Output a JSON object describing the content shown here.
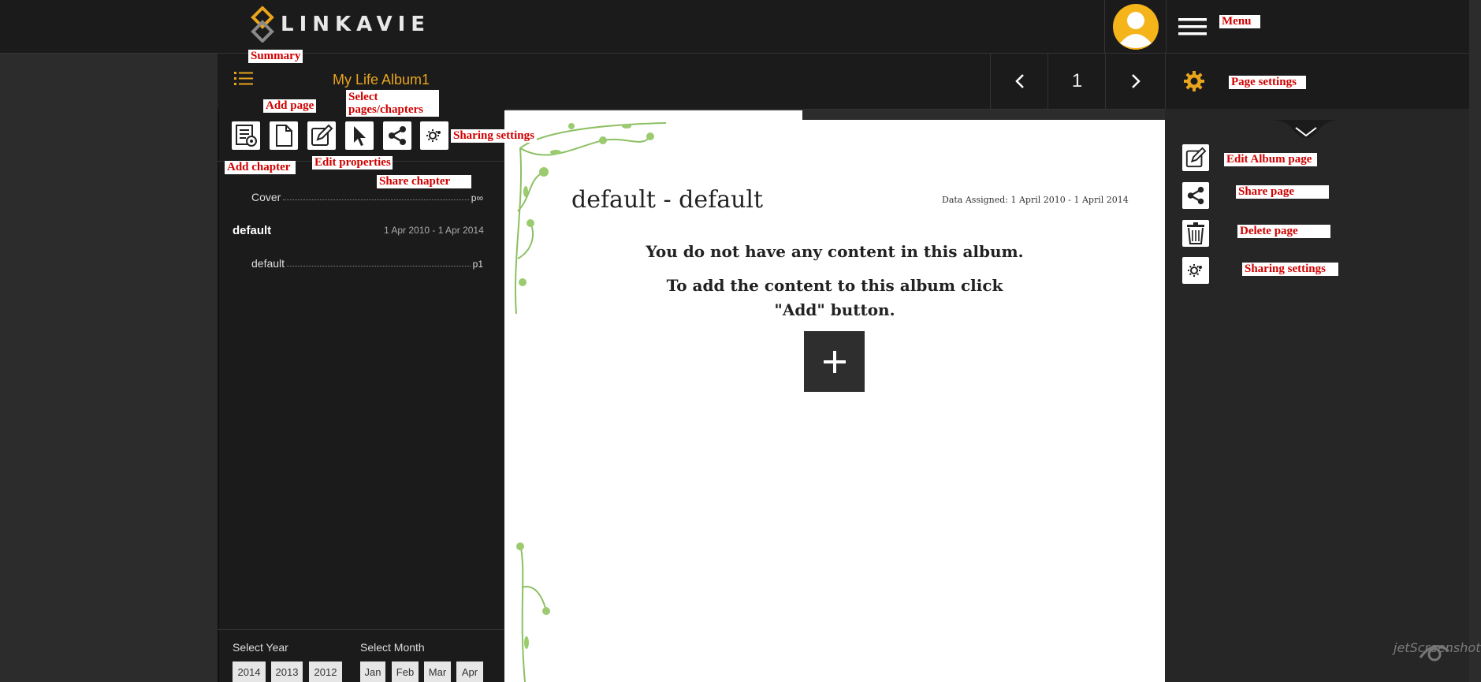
{
  "header": {
    "logo_text": "LINKAVIE"
  },
  "toolbar": {
    "album_title": "My Life Album1",
    "page_number": "1"
  },
  "toc": {
    "cover_label": "Cover",
    "cover_page": "p∞",
    "chapter_title": "default",
    "chapter_dates": "1 Apr 2010 - 1 Apr 2014",
    "page_label": "default",
    "page_ref": "p1"
  },
  "filters": {
    "year_label": "Select Year",
    "month_label": "Select Month",
    "years": [
      "2014",
      "2013",
      "2012"
    ],
    "months": [
      "Jan",
      "Feb",
      "Mar",
      "Apr"
    ]
  },
  "page": {
    "heading": "default - default",
    "date_assigned": "Data Assigned: 1 April 2010 - 1 April 2014",
    "empty_message": "You do not have any content in this album.",
    "add_instruction_line1": "To add the content to this album click",
    "add_instruction_line2": "\"Add\" button."
  },
  "annotations": {
    "summary": "Summary",
    "add_page": "Add page",
    "select_pages_line1": "Select",
    "select_pages_line2": "pages/chapters",
    "sharing_settings": "Sharing settings",
    "add_chapter": "Add chapter",
    "edit_properties": "Edit properties",
    "share_chapter": "Share chapter",
    "menu": "Menu",
    "page_settings": "Page settings",
    "edit_album_page": "Edit Album page",
    "share_page": "Share page",
    "delete_page": "Delete page",
    "right_sharing_settings": "Sharing settings"
  },
  "watermark": "jetScreenshot",
  "colors": {
    "accent": "#e8a41c",
    "annotation": "#d10000",
    "bar_bg": "#1b1b1b",
    "page_bg": "#ffffff"
  },
  "icons": [
    "logo-icon",
    "avatar-icon",
    "hamburger-icon",
    "list-icon",
    "chevron-left-icon",
    "chevron-right-icon",
    "gear-icon",
    "add-chapter-icon",
    "add-page-icon",
    "edit-icon",
    "cursor-icon",
    "share-icon",
    "sharing-settings-icon",
    "plus-icon",
    "chevron-down-icon",
    "trash-icon"
  ]
}
